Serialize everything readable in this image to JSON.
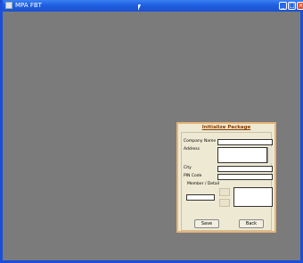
{
  "window": {
    "title": "MPA FBT"
  },
  "titlebar_buttons": {
    "minimize": "_",
    "maximize": "□",
    "close": "×"
  },
  "dialog": {
    "title": "Initialize Package",
    "labels": {
      "company_name": "Company Name :",
      "address": "Address",
      "city": "City",
      "pin_code": "PIN Code",
      "member_detail": "Member / Detail"
    },
    "fields": {
      "company_name": "",
      "address": "",
      "city": "",
      "pin_code": "",
      "member": ""
    },
    "buttons": {
      "save": "Save",
      "back": "Back"
    }
  },
  "colors": {
    "titlebar": "#1f5fe0",
    "background": "#808080",
    "dialog_bg": "#eee9d3",
    "dialog_border": "#e8b478",
    "title_text": "#8a3c00"
  }
}
